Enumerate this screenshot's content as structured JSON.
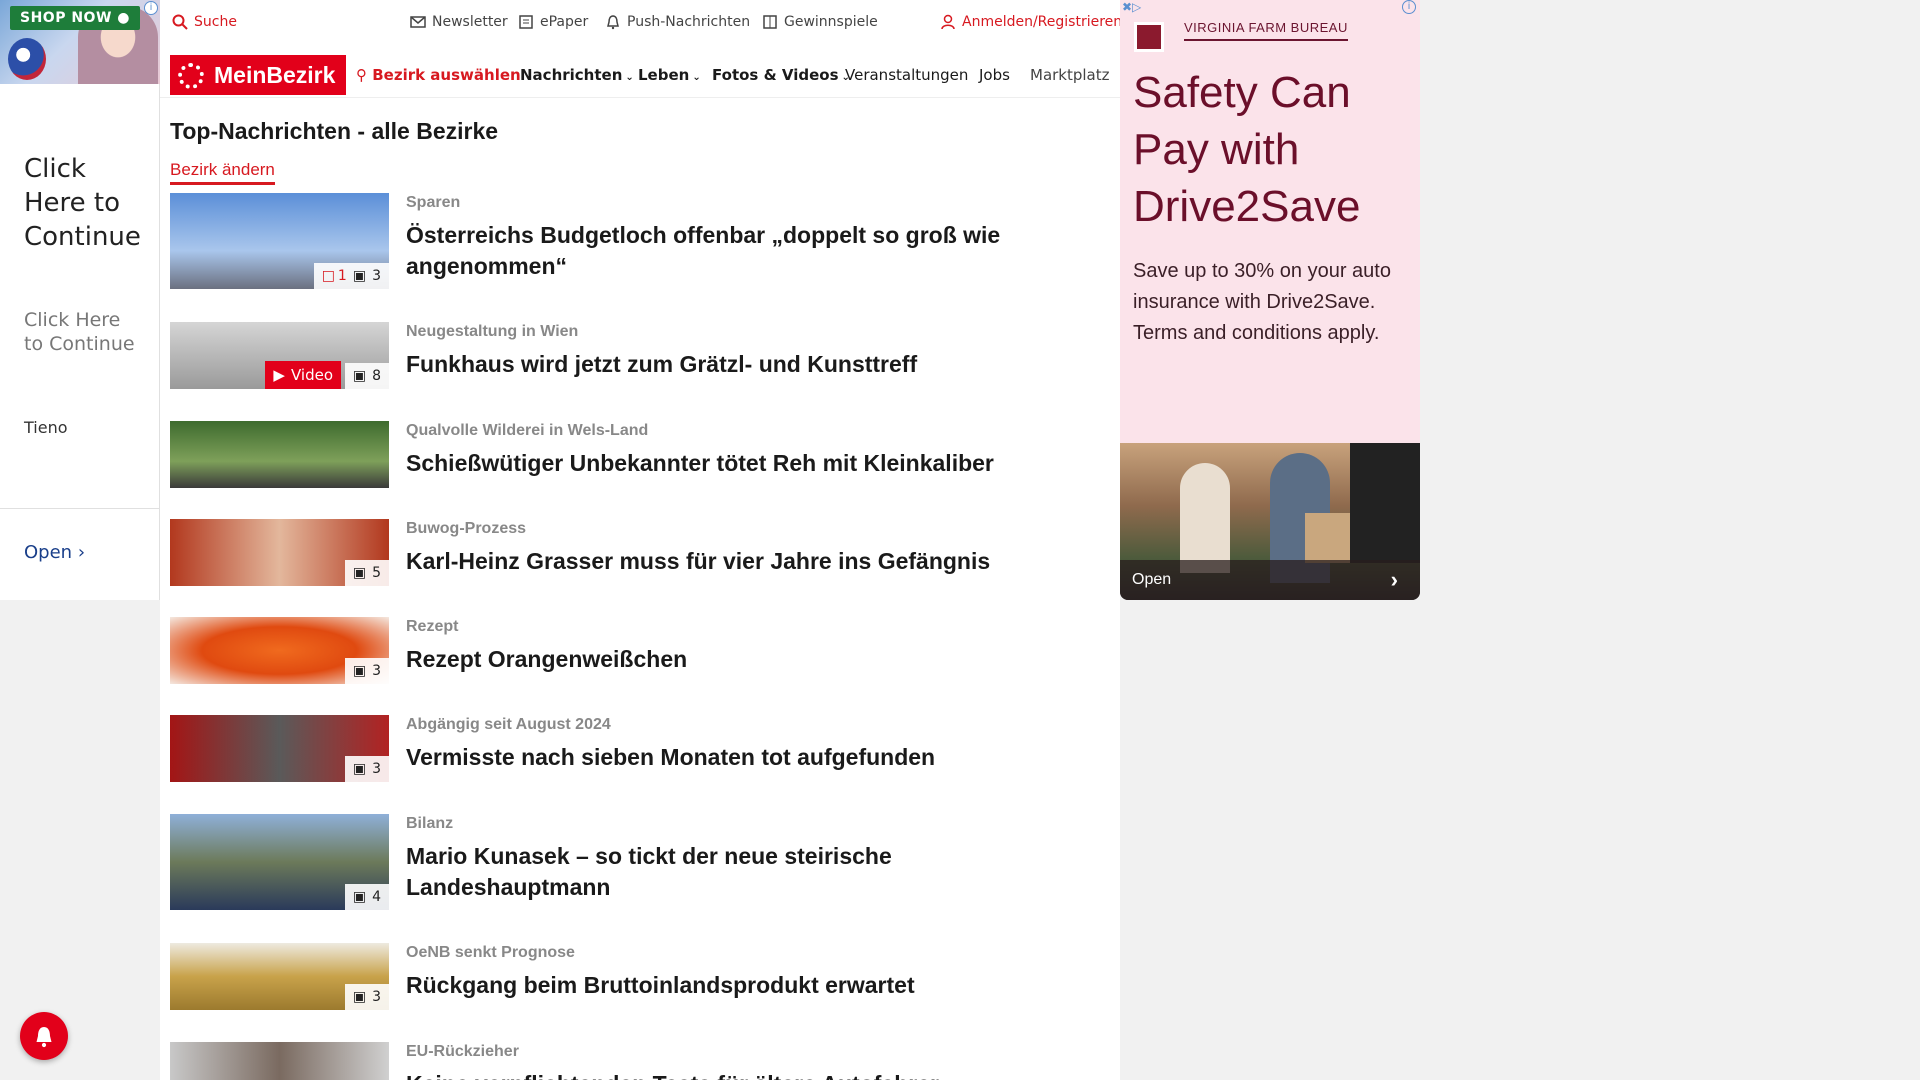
{
  "left_ad": {
    "shop_now": "SHOP NOW",
    "headline": "Click Here to Continue",
    "subline": "Click Here to Continue",
    "brand": "Tieno",
    "open_label": "Open"
  },
  "topbar": {
    "search": "Suche",
    "newsletter": "Newsletter",
    "epaper": "ePaper",
    "push": "Push-Nachrichten",
    "gewinnspiele": "Gewinnspiele",
    "login": "Anmelden/Registrieren"
  },
  "nav": {
    "logo": "MeinBezirk",
    "bezirk": "Bezirk auswählen",
    "items": [
      "Nachrichten",
      "Leben",
      "Fotos & Videos",
      "Veranstaltungen",
      "Jobs",
      "Marktplatz"
    ]
  },
  "section": {
    "title": "Top-Nachrichten - alle Bezirke",
    "change_link": "Bezirk ändern"
  },
  "articles": [
    {
      "kicker": "Sparen",
      "title": "Österreichs Budgetloch offenbar „doppelt so groß wie angenommen“",
      "comments": "1",
      "images": "3"
    },
    {
      "kicker": "Neugestaltung in Wien",
      "title": "Funkhaus wird jetzt zum Grätzl- und Kunsttreff",
      "video": "Video",
      "images": "8"
    },
    {
      "kicker": "Qualvolle Wilderei in Wels-Land",
      "title": "Schießwütiger Unbekannter tötet Reh mit Kleinkaliber"
    },
    {
      "kicker": "Buwog-Prozess",
      "title": "Karl-Heinz Grasser muss für vier Jahre ins Gefängnis",
      "images": "5"
    },
    {
      "kicker": "Rezept",
      "title": "Rezept Orangenweißchen",
      "images": "3"
    },
    {
      "kicker": "Abgängig seit August 2024",
      "title": "Vermisste nach sieben Monaten tot aufgefunden",
      "images": "3"
    },
    {
      "kicker": "Bilanz",
      "title": "Mario Kunasek – so tickt der neue steirische Landeshauptmann",
      "images": "4"
    },
    {
      "kicker": "OeNB senkt Prognose",
      "title": "Rückgang beim Bruttoinlandsprodukt erwartet",
      "images": "3"
    },
    {
      "kicker": "EU-Rückzieher",
      "title": "Keine verpflichtenden Tests für ältere Autofahrer"
    }
  ],
  "right_ad": {
    "advertiser": "VIRGINIA FARM BUREAU",
    "headline": "Safety Can Pay with Drive2Save",
    "body": "Save up to 30% on your auto insurance with Drive2Save. Terms and conditions apply.",
    "open_label": "Open"
  },
  "colors": {
    "brand_red": "#e2001a",
    "ad_bg": "#fbe3ea",
    "ad_text": "#6b0f2a"
  }
}
